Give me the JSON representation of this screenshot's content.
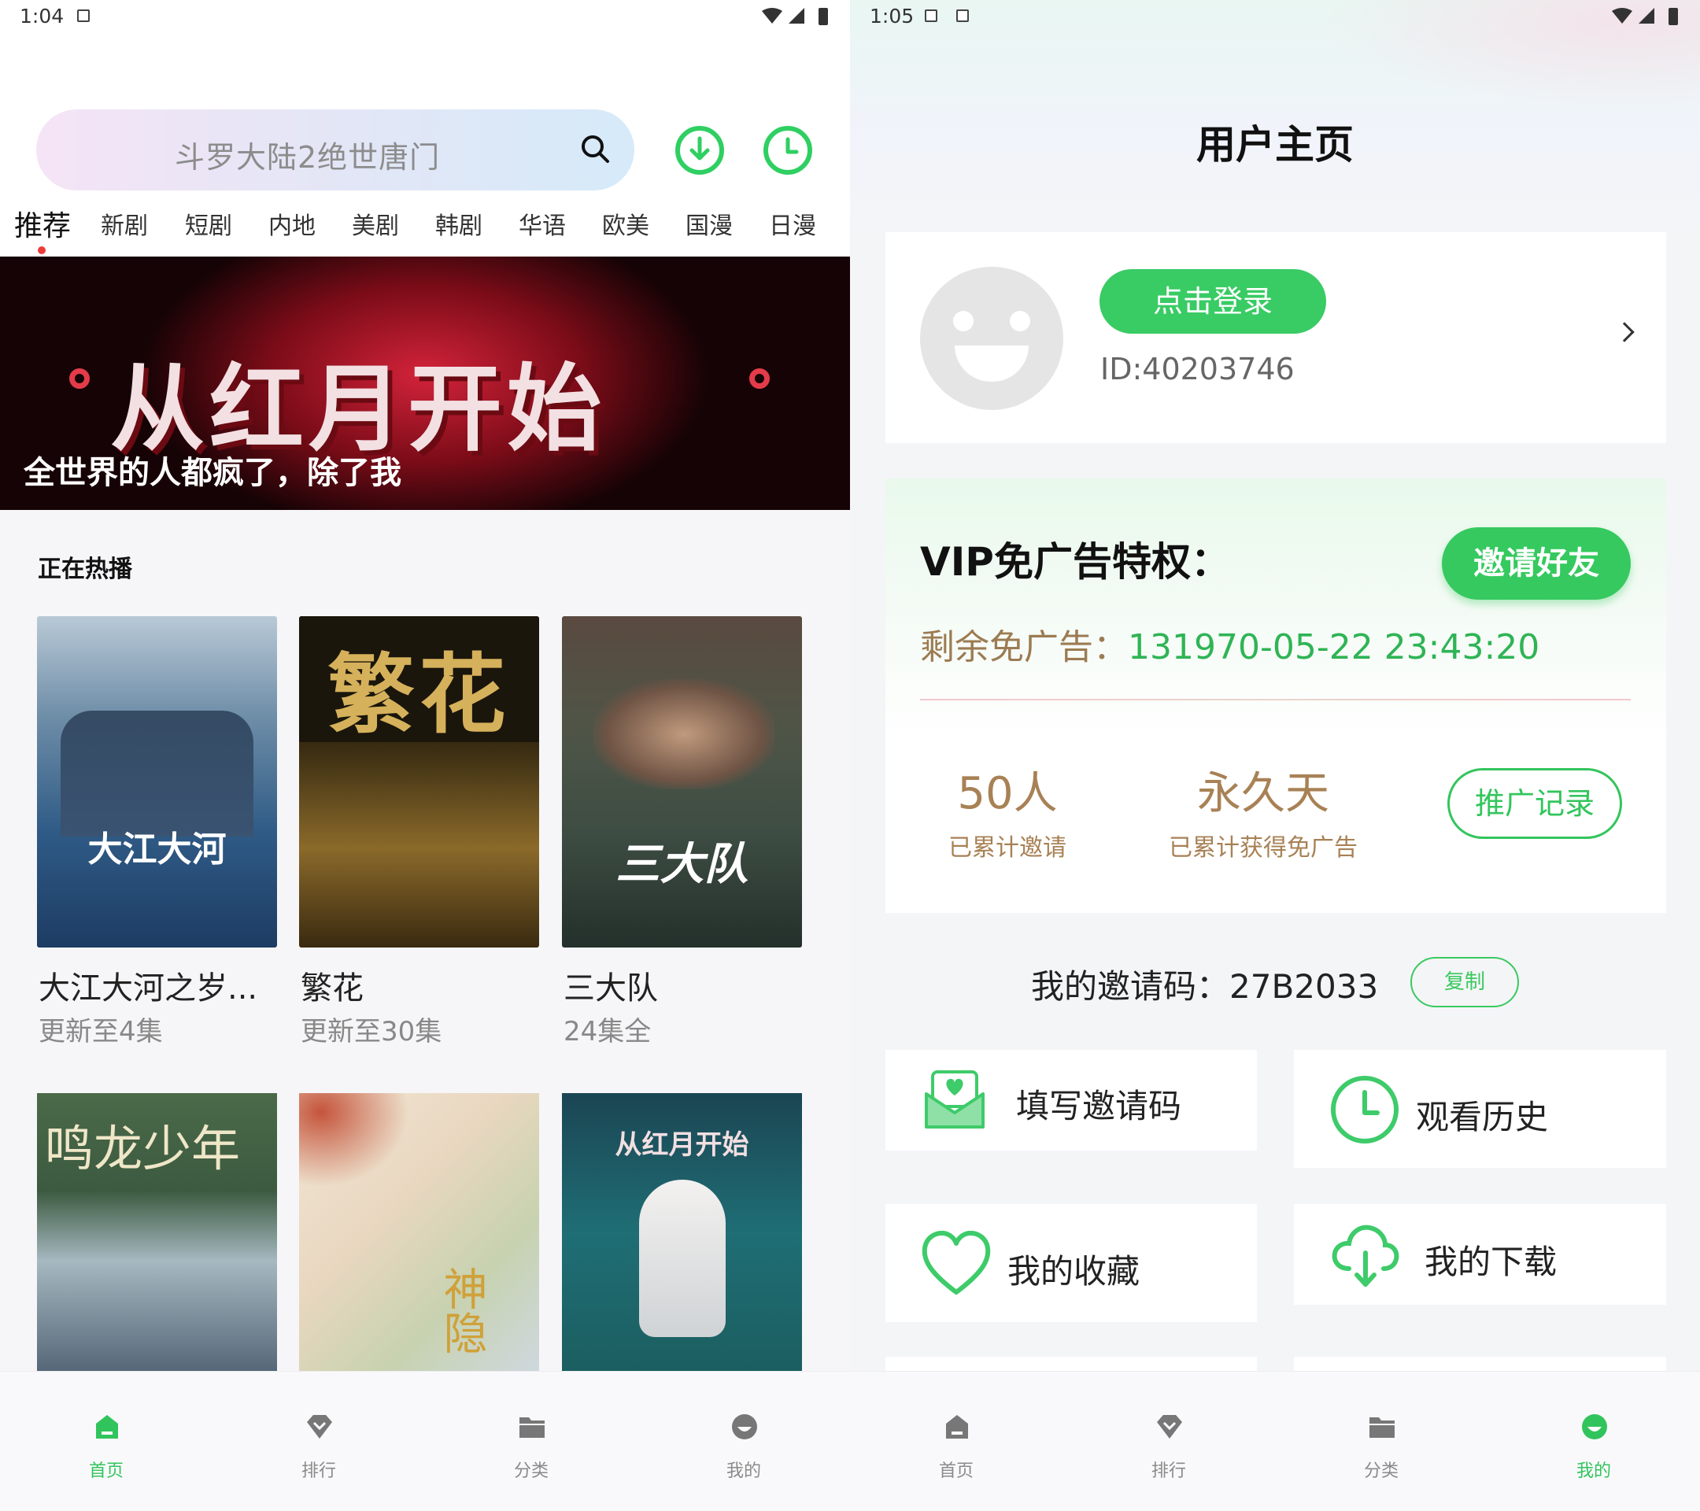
{
  "left": {
    "status": {
      "time": "1:04"
    },
    "search": {
      "placeholder": "斗罗大陆2绝世唐门"
    },
    "tabs": [
      "推荐",
      "新剧",
      "短剧",
      "内地",
      "美剧",
      "韩剧",
      "华语",
      "欧美",
      "国漫",
      "日漫"
    ],
    "banner": {
      "logo_text": "从红月开始",
      "caption": "全世界的人都疯了，除了我"
    },
    "section_title": "正在热播",
    "cards": [
      {
        "title": "大江大河之岁...",
        "sub": "更新至4集",
        "poster_text": "大江大河"
      },
      {
        "title": "繁花",
        "sub": "更新至30集",
        "poster_text": "繁花"
      },
      {
        "title": "三大队",
        "sub": "24集全",
        "poster_text": "三大队"
      }
    ],
    "row2_posters": [
      {
        "poster_text": "鸣龙少年"
      },
      {
        "poster_text": "神隐"
      },
      {
        "poster_text": "从红月开始"
      }
    ],
    "nav": [
      {
        "label": "首页",
        "icon": "home-icon",
        "active": true
      },
      {
        "label": "排行",
        "icon": "ranking-icon",
        "active": false
      },
      {
        "label": "分类",
        "icon": "folder-icon",
        "active": false
      },
      {
        "label": "我的",
        "icon": "profile-icon",
        "active": false
      }
    ]
  },
  "right": {
    "status": {
      "time": "1:05"
    },
    "page_title": "用户主页",
    "user": {
      "login_label": "点击登录",
      "id_text": "ID:40203746"
    },
    "vip": {
      "title": "VIP免广告特权：",
      "invite_label": "邀请好友",
      "remain_label": "剩余免广告：",
      "remain_value": "131970-05-22 23:43:20",
      "stat1_value": "50人",
      "stat1_label": "已累计邀请",
      "stat2_value": "永久天",
      "stat2_label": "已累计获得免广告",
      "record_label": "推广记录"
    },
    "invite_code": {
      "label": "我的邀请码：",
      "value": "27B2033",
      "copy_label": "复制"
    },
    "tiles": [
      {
        "label": "填写邀请码",
        "icon": "envelope-heart-icon"
      },
      {
        "label": "观看历史",
        "icon": "clock-icon"
      },
      {
        "label": "我的收藏",
        "icon": "heart-icon"
      },
      {
        "label": "我的下载",
        "icon": "cloud-download-icon"
      }
    ],
    "nav": [
      {
        "label": "首页",
        "icon": "home-icon",
        "active": false
      },
      {
        "label": "排行",
        "icon": "ranking-icon",
        "active": false
      },
      {
        "label": "分类",
        "icon": "folder-icon",
        "active": false
      },
      {
        "label": "我的",
        "icon": "profile-icon",
        "active": true
      }
    ]
  },
  "colors": {
    "accent": "#36c95f",
    "gold": "#a88155",
    "nav_inactive": "#8a8a8a"
  }
}
